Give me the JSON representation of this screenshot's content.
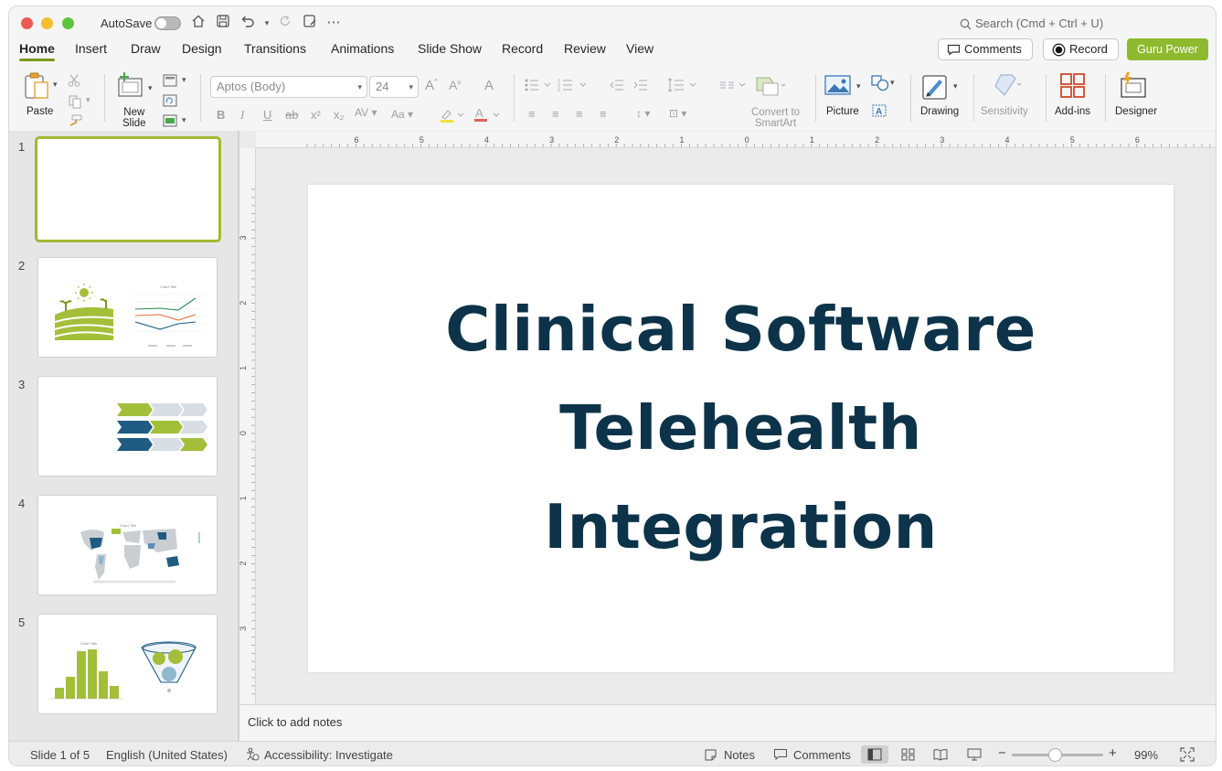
{
  "titlebar": {
    "autosave_label": "AutoSave",
    "search_placeholder": "Search (Cmd + Ctrl + U)"
  },
  "tabs": [
    "Home",
    "Insert",
    "Draw",
    "Design",
    "Transitions",
    "Animations",
    "Slide Show",
    "Record",
    "Review",
    "View"
  ],
  "active_tab": "Home",
  "header_buttons": {
    "comments": "Comments",
    "record": "Record",
    "guru": "Guru Power"
  },
  "ribbon": {
    "paste": "Paste",
    "new_slide_line1": "New",
    "new_slide_line2": "Slide",
    "font_name": "Aptos (Body)",
    "font_size": "24",
    "convert_line1": "Convert to",
    "convert_line2": "SmartArt",
    "picture": "Picture",
    "drawing": "Drawing",
    "sensitivity": "Sensitivity",
    "addins": "Add-ins",
    "designer": "Designer"
  },
  "slides": [
    {
      "number": "1",
      "selected": true
    },
    {
      "number": "2"
    },
    {
      "number": "3"
    },
    {
      "number": "4"
    },
    {
      "number": "5"
    }
  ],
  "ruler": {
    "h_ticks": [
      "6",
      "5",
      "4",
      "3",
      "2",
      "1",
      "0",
      "1",
      "2",
      "3",
      "4",
      "5",
      "6"
    ],
    "v_ticks": [
      "3",
      "2",
      "1",
      "0",
      "1",
      "2",
      "3"
    ]
  },
  "slide": {
    "title_lines": [
      "Clinical Software",
      "Telehealth",
      "Integration"
    ]
  },
  "notes_placeholder": "Click to add notes",
  "status": {
    "slide_count": "Slide 1 of 5",
    "language": "English (United States)",
    "accessibility": "Accessibility: Investigate",
    "notes": "Notes",
    "comments": "Comments",
    "zoom": "99%"
  },
  "colors": {
    "accent_green": "#8dba2e",
    "title_navy": "#0c3349",
    "chart_blue": "#1f5b82"
  }
}
